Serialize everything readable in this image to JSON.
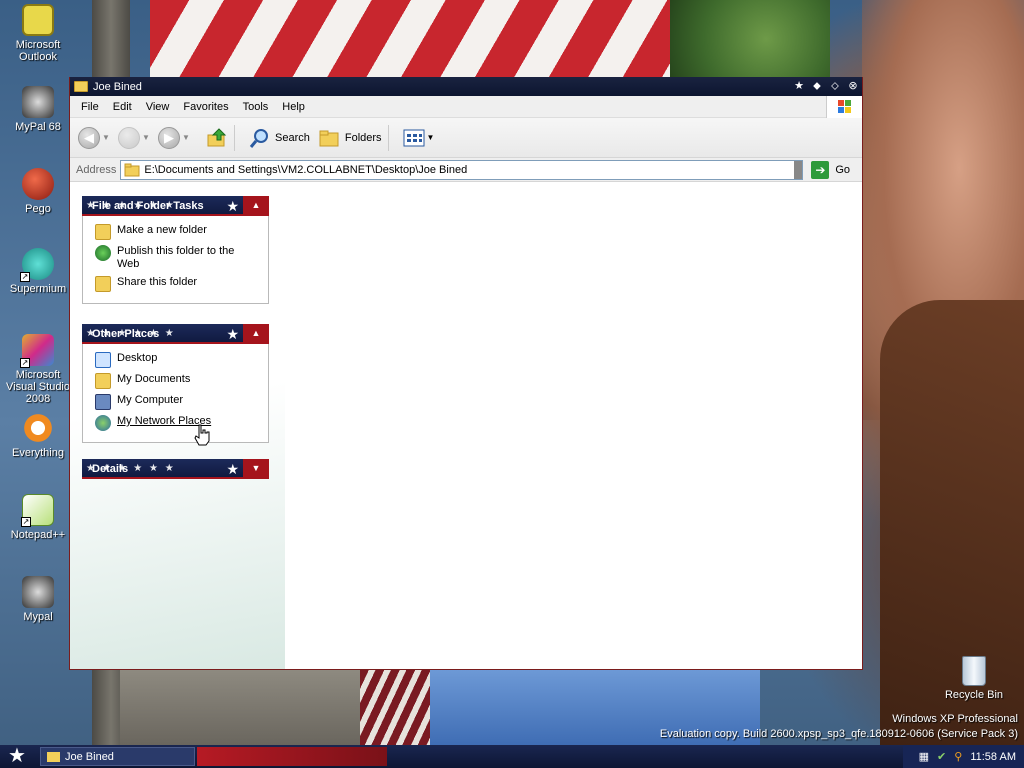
{
  "desktop": {
    "icons": [
      {
        "label": "Microsoft Outlook",
        "icon": "outlook-icon"
      },
      {
        "label": "MyPal 68",
        "icon": "mypal-icon"
      },
      {
        "label": "Pego",
        "icon": "pego-icon"
      },
      {
        "label": "Supermium",
        "icon": "supermium-icon"
      },
      {
        "label": "Microsoft Visual Studio 2008",
        "icon": "visual-studio-icon"
      },
      {
        "label": "Everything",
        "icon": "everything-icon"
      },
      {
        "label": "Notepad++",
        "icon": "notepadpp-icon"
      },
      {
        "label": "Mypal",
        "icon": "mypal-icon"
      }
    ],
    "recycle_bin": "Recycle Bin",
    "watermark_line1": "Windows XP Professional",
    "watermark_line2": "Evaluation copy. Build 2600.xpsp_sp3_qfe.180912-0606 (Service Pack 3)"
  },
  "window": {
    "title": "Joe Bined",
    "menu": [
      "File",
      "Edit",
      "View",
      "Favorites",
      "Tools",
      "Help"
    ],
    "toolbar": {
      "search": "Search",
      "folders": "Folders"
    },
    "address": {
      "label": "Address",
      "value": "E:\\Documents and Settings\\VM2.COLLABNET\\Desktop\\Joe Bined",
      "go": "Go"
    },
    "panels": {
      "file_tasks": {
        "title": "File and Folder Tasks",
        "items": [
          {
            "label": "Make a new folder",
            "icon": "new-folder-icon"
          },
          {
            "label": "Publish this folder to the Web",
            "icon": "globe-icon"
          },
          {
            "label": "Share this folder",
            "icon": "share-folder-icon"
          }
        ]
      },
      "other_places": {
        "title": "Other Places",
        "items": [
          {
            "label": "Desktop",
            "icon": "desktop-icon"
          },
          {
            "label": "My Documents",
            "icon": "my-documents-icon"
          },
          {
            "label": "My Computer",
            "icon": "my-computer-icon"
          },
          {
            "label": "My Network Places",
            "icon": "network-places-icon"
          }
        ]
      },
      "details": {
        "title": "Details"
      }
    }
  },
  "taskbar": {
    "task_label": "Joe Bined",
    "clock": "11:58 AM"
  },
  "colors": {
    "theme_navy": "#101a40",
    "theme_red": "#a5141c"
  }
}
